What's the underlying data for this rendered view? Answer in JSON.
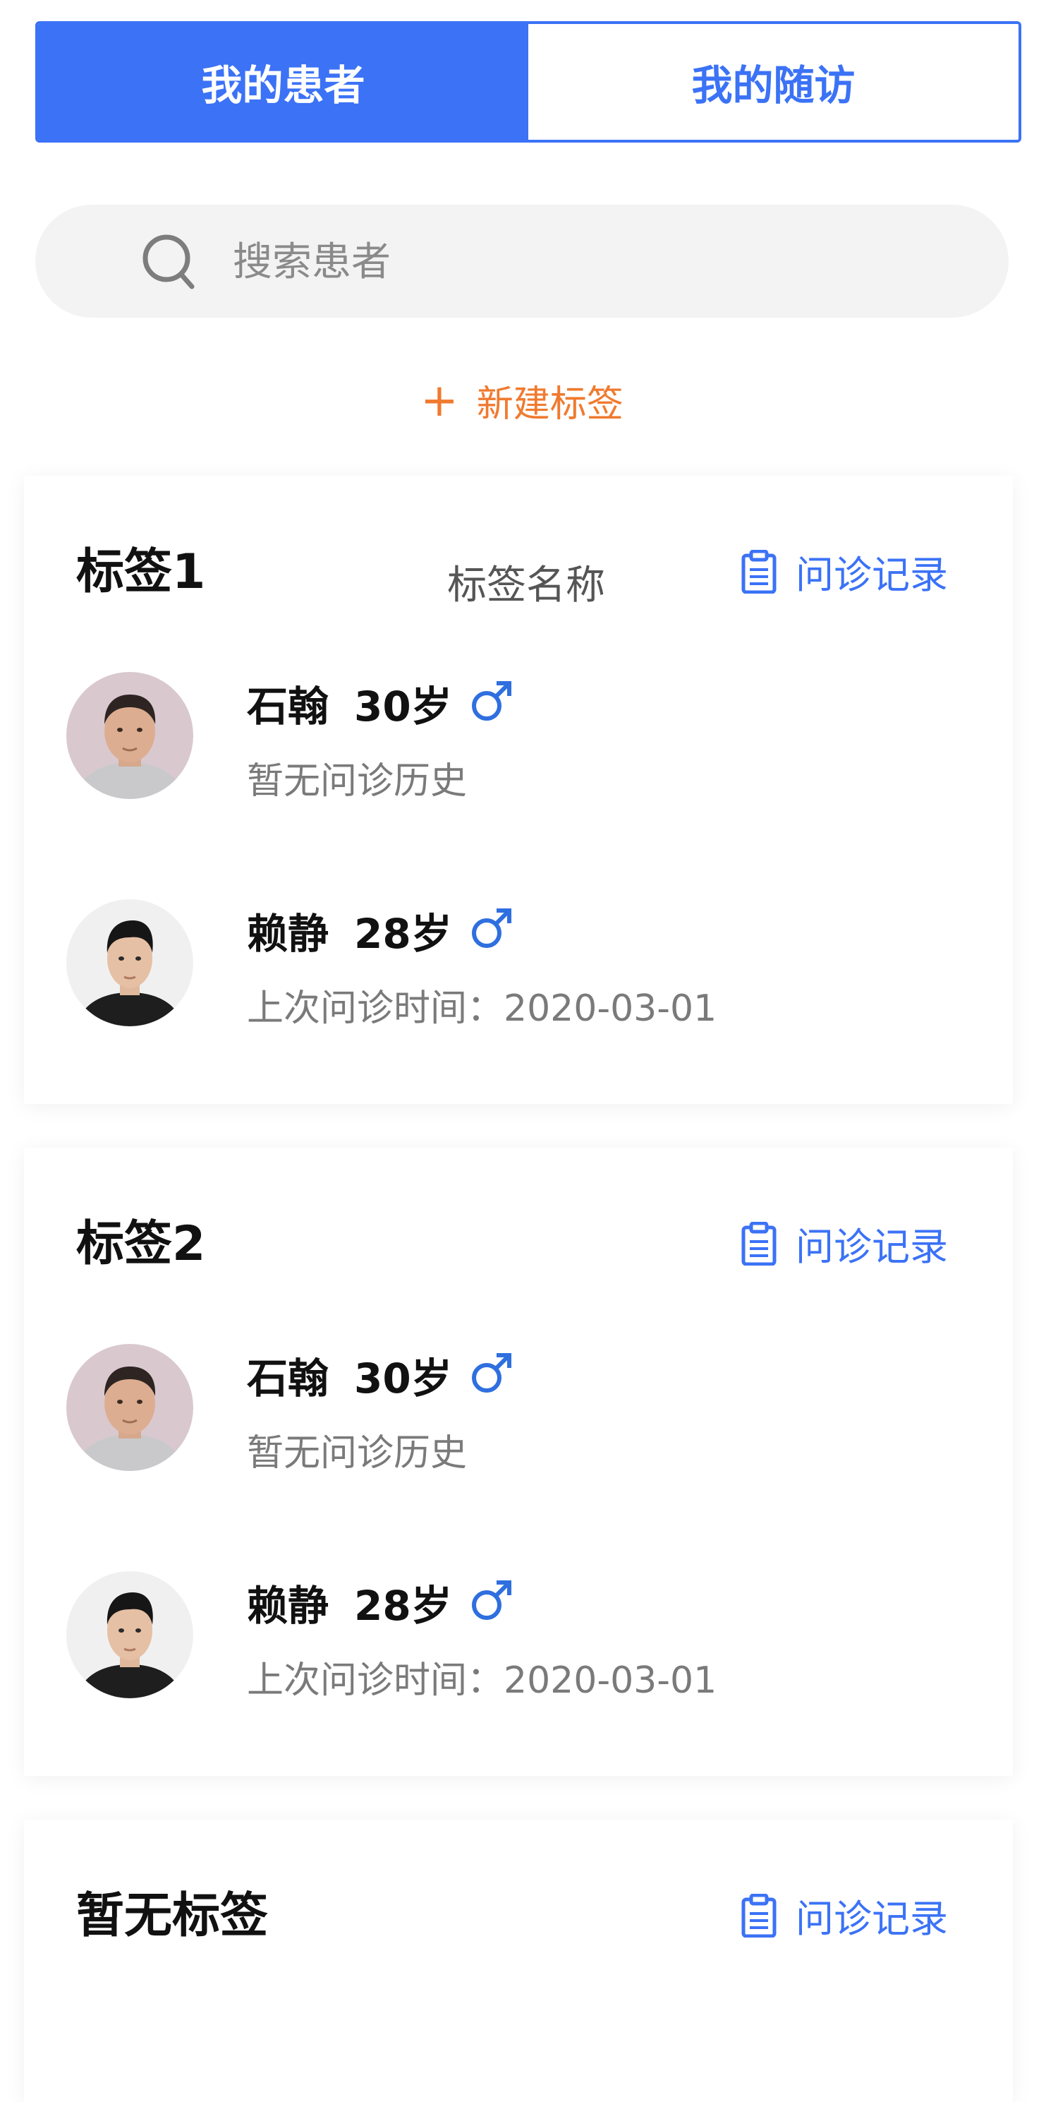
{
  "tabs": [
    {
      "label": "我的患者"
    },
    {
      "label": "我的随访"
    }
  ],
  "search": {
    "placeholder": "搜索患者"
  },
  "new_tag": {
    "plus": "+",
    "label": "新建标签"
  },
  "record_label": "问诊记录",
  "cards": [
    {
      "title": "标签1",
      "subtitle": "标签名称",
      "patients": [
        {
          "name": "石翰",
          "age": "30岁",
          "gender_icon": "male-icon",
          "history": "暂无问诊历史"
        },
        {
          "name": "赖静",
          "age": "28岁",
          "gender_icon": "male-icon",
          "history": "上次问诊时间：2020-03-01"
        }
      ]
    },
    {
      "title": "标签2",
      "patients": [
        {
          "name": "石翰",
          "age": "30岁",
          "gender_icon": "male-icon",
          "history": "暂无问诊历史"
        },
        {
          "name": "赖静",
          "age": "28岁",
          "gender_icon": "male-icon",
          "history": "上次问诊时间：2020-03-01"
        }
      ]
    },
    {
      "title": "暂无标签"
    }
  ],
  "colors": {
    "accent": "#3b72f6",
    "orange": "#f07a2f",
    "search_bg": "#f3f3f3",
    "muted_text": "#7a7a7a"
  }
}
